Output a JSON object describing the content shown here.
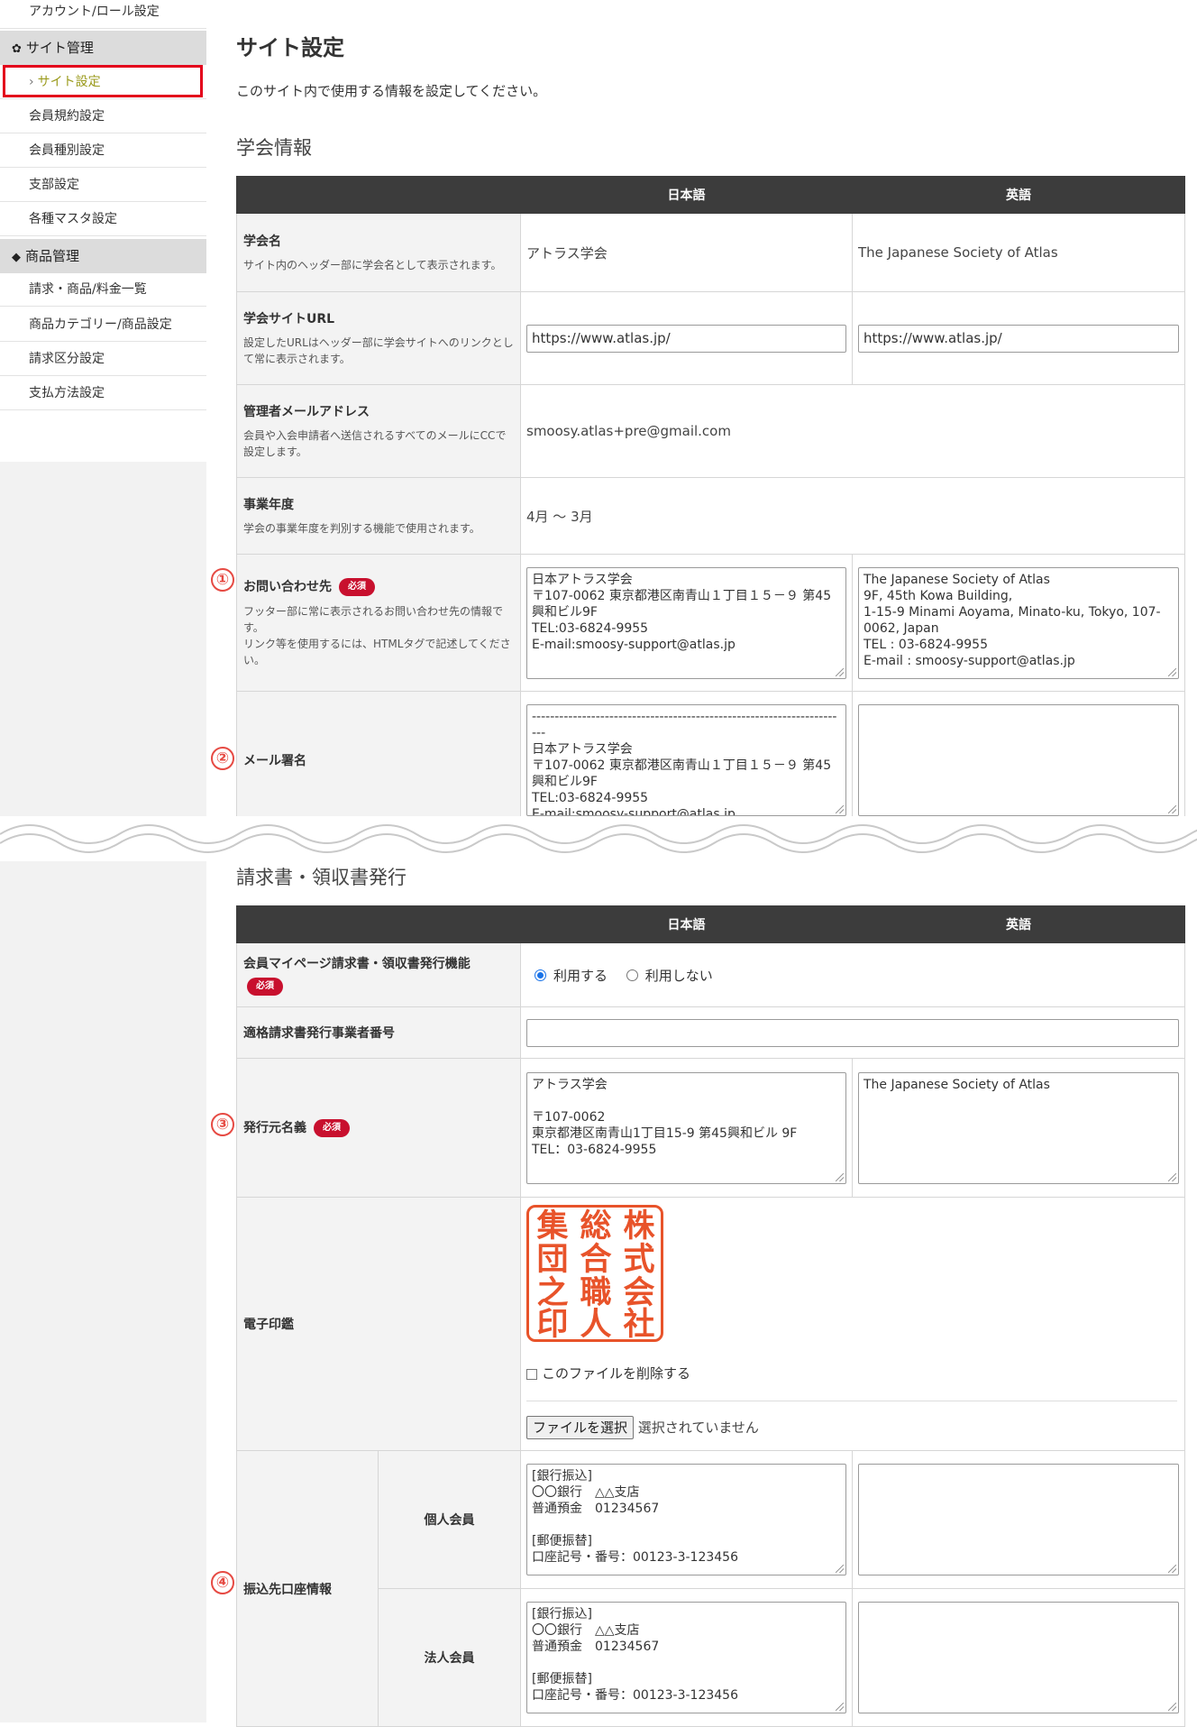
{
  "sidebar": {
    "account_role": "アカウント/ロール設定",
    "site_group": {
      "icon": "gear-icon",
      "label": "サイト管理"
    },
    "site_items": [
      "サイト設定",
      "会員規約設定",
      "会員種別設定",
      "支部設定",
      "各種マスタ設定"
    ],
    "product_group": {
      "icon": "tag-icon",
      "label": "商品管理"
    },
    "product_items": [
      "請求・商品/料金一覧",
      "商品カテゴリー/商品設定",
      "請求区分設定",
      "支払方法設定"
    ]
  },
  "page": {
    "title": "サイト設定",
    "description": "このサイト内で使用する情報を設定してください。"
  },
  "society": {
    "section_title": "学会情報",
    "col_ja": "日本語",
    "col_en": "英語",
    "name": {
      "label": "学会名",
      "desc": "サイト内のヘッダー部に学会名として表示されます。",
      "ja": "アトラス学会",
      "en": "The Japanese Society of Atlas"
    },
    "url": {
      "label": "学会サイトURL",
      "desc": "設定したURLはヘッダー部に学会サイトへのリンクとして常に表示されます。",
      "ja": "https://www.atlas.jp/",
      "en": "https://www.atlas.jp/"
    },
    "admin_email": {
      "label": "管理者メールアドレス",
      "desc": "会員や入会申請者へ送信されるすべてのメールにCCで設定します。",
      "value": "smoosy.atlas+pre@gmail.com"
    },
    "fiscal_year": {
      "label": "事業年度",
      "desc": "学会の事業年度を判別する機能で使用されます。",
      "value": "4月 ～ 3月"
    },
    "contact": {
      "marker": "①",
      "label": "お問い合わせ先",
      "required": "必須",
      "desc": "フッター部に常に表示されるお問い合わせ先の情報です。\nリンク等を使用するには、HTMLタグで記述してください。",
      "ja": "日本アトラス学会\n〒107-0062 東京都港区南青山１丁目１５－９ 第45興和ビル9F\nTEL:03-6824-9955\nE-mail:smoosy-support@atlas.jp",
      "en": "The Japanese Society of Atlas\n9F, 45th Kowa Building,\n1-15-9 Minami Aoyama, Minato-ku, Tokyo, 107-0062, Japan\nTEL : 03-6824-9955\nE-mail : smoosy-support@atlas.jp"
    },
    "signature": {
      "marker": "②",
      "label": "メール署名",
      "ja": "----------------------------------------------------------------------\n日本アトラス学会\n〒107-0062 東京都港区南青山１丁目１５－９ 第45興和ビル9F\nTEL:03-6824-9955\nE-mail:smoosy-support@atlas.jp",
      "en": ""
    }
  },
  "invoice": {
    "section_title": "請求書・領収書発行",
    "col_ja": "日本語",
    "col_en": "英語",
    "mypage_feature": {
      "label": "会員マイページ請求書・領収書発行機能",
      "required": "必須",
      "opt_use": "利用する",
      "opt_nouse": "利用しない",
      "selected": "利用する"
    },
    "registration_no": {
      "label": "適格請求書発行事業者番号",
      "value": ""
    },
    "issuer": {
      "marker": "③",
      "label": "発行元名義",
      "required": "必須",
      "ja": "アトラス学会\n\n〒107-0062\n東京都港区南青山1丁目15-9 第45興和ビル 9F\nTEL：03-6824-9955",
      "en": "The Japanese Society of Atlas"
    },
    "seal": {
      "label": "電子印鑑",
      "chars": [
        "株",
        "総",
        "集",
        "式",
        "合",
        "団",
        "会",
        "職",
        "之",
        "社",
        "人",
        "印"
      ],
      "color": "#e8532a",
      "delete_label": "このファイルを削除する",
      "file_button": "ファイルを選択",
      "file_status": "選択されていません"
    },
    "bank": {
      "marker": "④",
      "label": "振込先口座情報",
      "individual": {
        "label": "個人会員",
        "ja": "[銀行振込]\n〇〇銀行　△△支店\n普通預金　01234567\n\n[郵便振替]\n口座記号・番号：00123-3-123456",
        "en": ""
      },
      "corporate": {
        "label": "法人会員",
        "ja": "[銀行振込]\n〇〇銀行　△△支店\n普通預金　01234567\n\n[郵便振替]\n口座記号・番号：00123-3-123456",
        "en": ""
      }
    }
  },
  "colors": {
    "accent_red": "#e3001b",
    "required_badge": "#c8102e",
    "marker_red": "#e64a43",
    "header_bg": "#3c3c3c",
    "active_nav": "#9b9b1d"
  }
}
